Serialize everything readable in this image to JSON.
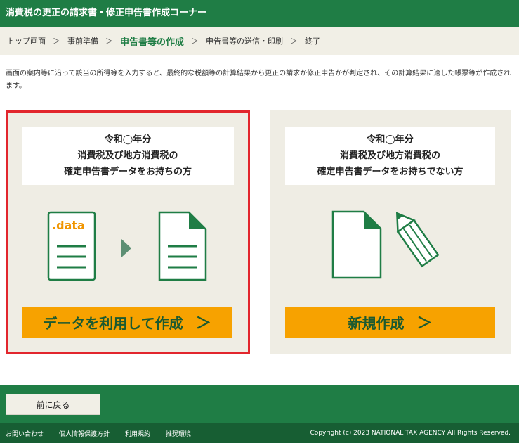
{
  "header": {
    "title": "消費税の更正の請求書・修正申告書作成コーナー"
  },
  "breadcrumb": {
    "items": [
      "トップ画面",
      "事前準備",
      "申告書等の作成",
      "申告書等の送信・印刷",
      "終了"
    ],
    "active_index": 2,
    "separator": "＞"
  },
  "intro": {
    "text": "画面の案内等に沿って該当の所得等を入力すると、最終的な税額等の計算結果から更正の請求か修正申告かが判定され、その計算結果に適した帳票等が作成されます。"
  },
  "cards": [
    {
      "lines": [
        "令和◯年分",
        "消費税及び地方消費税の",
        "確定申告書データをお持ちの方"
      ],
      "file_label": ".data",
      "button_label": "データを利用して作成",
      "chevron": "＞",
      "selected": true
    },
    {
      "lines": [
        "令和◯年分",
        "消費税及び地方消費税の",
        "確定申告書データをお持ちでない方"
      ],
      "button_label": "新規作成",
      "chevron": "＞",
      "selected": false
    }
  ],
  "footer": {
    "back_label": "前に戻る",
    "links": [
      "お問い合わせ",
      "個人情報保護方針",
      "利用規約",
      "推奨環境"
    ],
    "copyright": "Copyright (c) 2023 NATIONAL TAX AGENCY All Rights Reserved."
  },
  "colors": {
    "brand_green": "#1f7d45",
    "cta_orange": "#f7a200",
    "selected_border": "#e2262d",
    "card_bg": "#efede4"
  }
}
